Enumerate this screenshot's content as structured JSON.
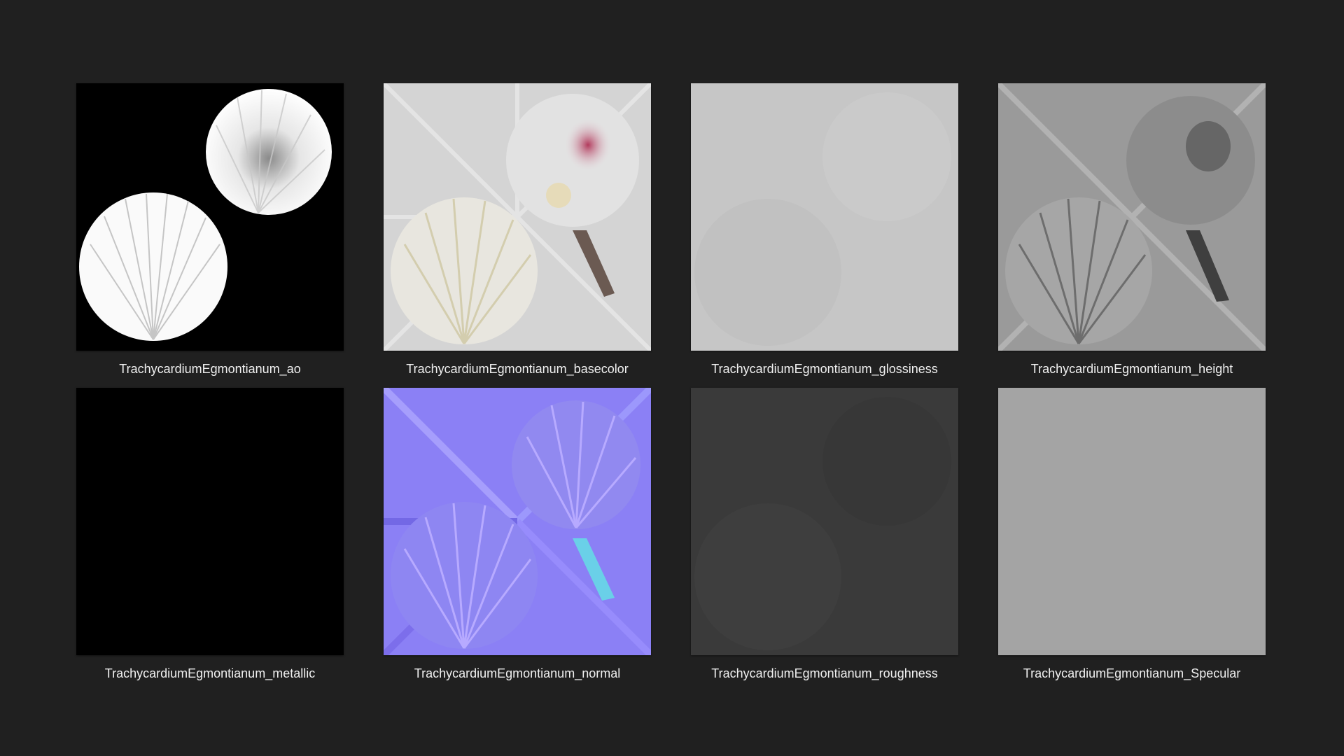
{
  "window": {
    "background": "#202020"
  },
  "files": [
    {
      "name": "TrachycardiumEgmontianum_ao",
      "map": "ao"
    },
    {
      "name": "TrachycardiumEgmontianum_basecolor",
      "map": "basecolor"
    },
    {
      "name": "TrachycardiumEgmontianum_glossiness",
      "map": "glossiness"
    },
    {
      "name": "TrachycardiumEgmontianum_height",
      "map": "height"
    },
    {
      "name": "TrachycardiumEgmontianum_metallic",
      "map": "metallic"
    },
    {
      "name": "TrachycardiumEgmontianum_normal",
      "map": "normal"
    },
    {
      "name": "TrachycardiumEgmontianum_roughness",
      "map": "roughness"
    },
    {
      "name": "TrachycardiumEgmontianum_Specular",
      "map": "specular"
    }
  ],
  "colors": {
    "caption_text": "#f0f0f0",
    "metallic_fill": "#000000",
    "glossiness_fill": "#c6c6c6",
    "roughness_fill": "#3a3a3a",
    "specular_fill": "#a4a4a4",
    "normal_fill": "#8b80f5"
  }
}
